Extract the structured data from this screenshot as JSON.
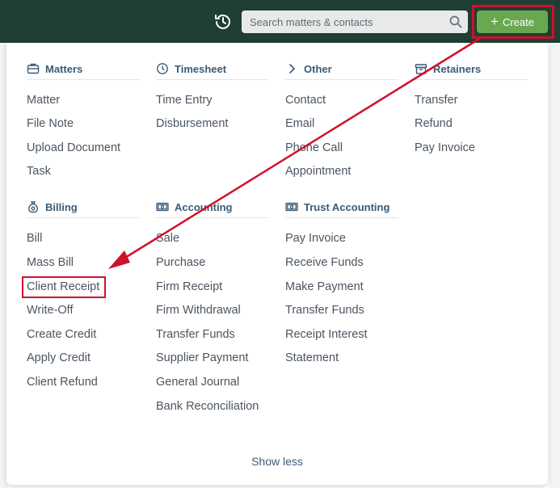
{
  "header": {
    "search_placeholder": "Search matters & contacts",
    "create_label": "Create",
    "create_icon": "plus-icon"
  },
  "sections": {
    "matters": {
      "title": "Matters",
      "icon": "briefcase-icon",
      "items": [
        "Matter",
        "File Note",
        "Upload Document",
        "Task"
      ]
    },
    "timesheet": {
      "title": "Timesheet",
      "icon": "clock-icon",
      "items": [
        "Time Entry",
        "Disbursement"
      ]
    },
    "other": {
      "title": "Other",
      "icon": "chevron-right-icon",
      "items": [
        "Contact",
        "Email",
        "Phone Call",
        "Appointment"
      ]
    },
    "retainers": {
      "title": "Retainers",
      "icon": "archive-icon",
      "items": [
        "Transfer",
        "Refund",
        "Pay Invoice"
      ]
    },
    "billing": {
      "title": "Billing",
      "icon": "money-bag-icon",
      "items": [
        "Bill",
        "Mass Bill",
        "Client Receipt",
        "Write-Off",
        "Create Credit",
        "Apply Credit",
        "Client Refund"
      ]
    },
    "accounting": {
      "title": "Accounting",
      "icon": "banknote-icon",
      "items": [
        "Sale",
        "Purchase",
        "Firm Receipt",
        "Firm Withdrawal",
        "Transfer Funds",
        "Supplier Payment",
        "General Journal",
        "Bank Reconciliation"
      ]
    },
    "trust_accounting": {
      "title": "Trust Accounting",
      "icon": "banknote-icon",
      "items": [
        "Pay Invoice",
        "Receive Funds",
        "Make Payment",
        "Transfer Funds",
        "Receipt Interest",
        "Statement"
      ]
    }
  },
  "footer": {
    "show_less_label": "Show less"
  },
  "colors": {
    "topbar": "#1f3f33",
    "create_button": "#6aa84f",
    "annotation": "#d0102a",
    "section_title": "#3b5a78"
  }
}
